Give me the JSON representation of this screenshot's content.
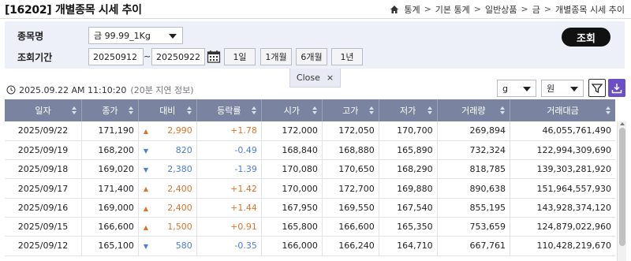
{
  "header": {
    "title": "[16202] 개별종목 시세 추이",
    "breadcrumb": [
      "통계",
      "기본 통계",
      "일반상품",
      "금",
      "개별종목 시세 추이"
    ]
  },
  "search": {
    "stock_label": "종목명",
    "stock_value": "금 99.99_1Kg",
    "period_label": "조회기간",
    "date_from": "20250912",
    "tilde": "~",
    "date_to": "20250922",
    "period_buttons": [
      "1일",
      "1개월",
      "6개월",
      "1년"
    ],
    "search_button": "조회",
    "close_label": "Close",
    "close_x": "×"
  },
  "status": {
    "timestamp": "2025.09.22 AM 11:10:20",
    "note": "(20분 지연 정보)",
    "unit_weight": "g",
    "unit_currency": "원"
  },
  "colors": {
    "header_bg": "#7a84a0",
    "up": "#e0732a",
    "down": "#4a7fd6",
    "accent": "#6b4fc7"
  },
  "table": {
    "columns": [
      "일자",
      "종가",
      "대비",
      "등락률",
      "시가",
      "고가",
      "저가",
      "거래량",
      "거래대금"
    ],
    "rows": [
      {
        "date": "2025/09/22",
        "close": "171,190",
        "dir": "up",
        "arrow": "▲",
        "diff": "2,990",
        "rate": "+1.78",
        "open": "172,000",
        "high": "172,050",
        "low": "170,700",
        "volume": "269,894",
        "amount": "46,055,761,490"
      },
      {
        "date": "2025/09/19",
        "close": "168,200",
        "dir": "down",
        "arrow": "▼",
        "diff": "820",
        "rate": "-0.49",
        "open": "168,840",
        "high": "168,880",
        "low": "165,890",
        "volume": "732,324",
        "amount": "122,994,309,690"
      },
      {
        "date": "2025/09/18",
        "close": "169,020",
        "dir": "down",
        "arrow": "▼",
        "diff": "2,380",
        "rate": "-1.39",
        "open": "170,080",
        "high": "170,650",
        "low": "168,290",
        "volume": "818,785",
        "amount": "139,303,281,920"
      },
      {
        "date": "2025/09/17",
        "close": "171,400",
        "dir": "up",
        "arrow": "▲",
        "diff": "2,400",
        "rate": "+1.42",
        "open": "170,000",
        "high": "172,700",
        "low": "169,880",
        "volume": "890,638",
        "amount": "151,964,557,930"
      },
      {
        "date": "2025/09/16",
        "close": "169,000",
        "dir": "up",
        "arrow": "▲",
        "diff": "2,400",
        "rate": "+1.44",
        "open": "167,950",
        "high": "169,550",
        "low": "167,540",
        "volume": "855,195",
        "amount": "143,928,374,120"
      },
      {
        "date": "2025/09/15",
        "close": "166,600",
        "dir": "up",
        "arrow": "▲",
        "diff": "1,500",
        "rate": "+0.91",
        "open": "165,800",
        "high": "166,600",
        "low": "165,350",
        "volume": "753,659",
        "amount": "124,879,022,960"
      },
      {
        "date": "2025/09/12",
        "close": "165,100",
        "dir": "down",
        "arrow": "▼",
        "diff": "580",
        "rate": "-0.35",
        "open": "166,000",
        "high": "166,240",
        "low": "164,710",
        "volume": "667,761",
        "amount": "110,428,219,670"
      }
    ]
  }
}
